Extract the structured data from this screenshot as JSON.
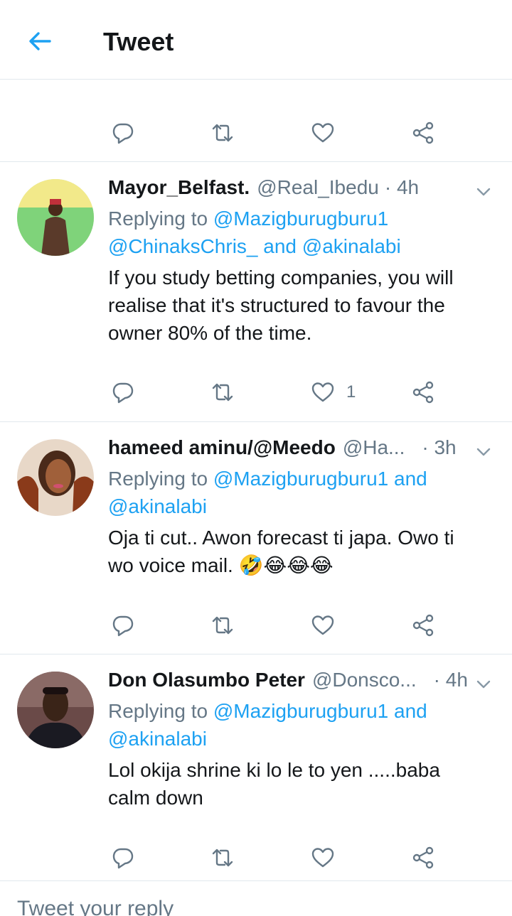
{
  "header": {
    "title": "Tweet"
  },
  "tweets": [
    {
      "name": "Mayor_Belfast.",
      "handle": "@Real_Ibedu",
      "time": "· 4h",
      "replying_prefix": "Replying to ",
      "reply_line1_link": "@Mazigburugburu1",
      "reply_line2_link1": "@ChinaksChris_",
      "reply_line2_and": " and ",
      "reply_line2_link2": "@akinalabi",
      "text_lines": [
        "If you study betting companies, you will",
        "realise that it's structured to favour the",
        "owner 80% of the time."
      ],
      "like_count": "1"
    },
    {
      "name": "hameed aminu/@Meedo",
      "handle": "@Ha...",
      "time": "· 3h",
      "replying_prefix": "Replying to ",
      "reply_line1_link": "@Mazigburugburu1",
      "reply_line1_and": " and",
      "reply_line2_link": "@akinalabi",
      "text_lines": [
        "Oja ti cut.. Awon forecast ti japa. Owo ti",
        "wo voice mail. "
      ],
      "emojis": "🤣😂😂😂"
    },
    {
      "name": "Don Olasumbo Peter",
      "handle": "@Donsco...",
      "time": "· 4h",
      "replying_prefix": "Replying to ",
      "reply_line1_link": "@Mazigburugburu1",
      "reply_line1_and": " and",
      "reply_line2_link": "@akinalabi",
      "text_lines": [
        "Lol okija shrine ki lo le to yen .....baba",
        "calm down"
      ]
    }
  ],
  "compose": {
    "placeholder": "Tweet your reply"
  },
  "colors": {
    "accent": "#1da1f2",
    "muted": "#657786",
    "text": "#14171a",
    "divider": "#e1e8ed"
  },
  "icons": [
    "back-arrow-icon",
    "reply-icon",
    "retweet-icon",
    "like-icon",
    "share-icon",
    "chevron-down-icon"
  ]
}
